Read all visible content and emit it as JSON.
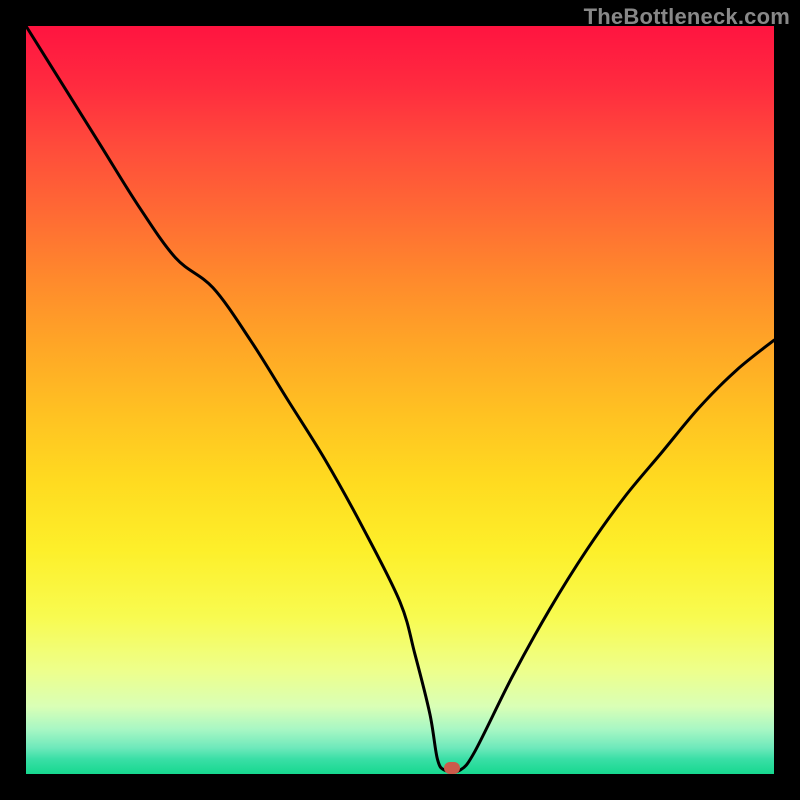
{
  "watermark": "TheBottleneck.com",
  "colors": {
    "frame": "#000000",
    "curve_stroke": "#000000",
    "marker": "#cb5b4b"
  },
  "chart_data": {
    "type": "line",
    "title": "",
    "xlabel": "",
    "ylabel": "",
    "xlim": [
      0,
      100
    ],
    "ylim": [
      0,
      100
    ],
    "grid": false,
    "legend": false,
    "x": [
      0,
      5,
      10,
      15,
      20,
      25,
      30,
      35,
      40,
      45,
      50,
      52,
      54,
      55,
      56,
      58,
      60,
      65,
      70,
      75,
      80,
      85,
      90,
      95,
      100
    ],
    "values": [
      100,
      92,
      84,
      76,
      69,
      65,
      58,
      50,
      42,
      33,
      23,
      16,
      8,
      2,
      0.5,
      0.5,
      3,
      13,
      22,
      30,
      37,
      43,
      49,
      54,
      58
    ],
    "marker": {
      "x": 57,
      "y": 0.8
    },
    "gradient_stops": [
      {
        "pos": 0,
        "color": "#ff1440"
      },
      {
        "pos": 25,
        "color": "#ff6a34"
      },
      {
        "pos": 52,
        "color": "#ffc222"
      },
      {
        "pos": 79,
        "color": "#f8fb50"
      },
      {
        "pos": 94,
        "color": "#a8f7c4"
      },
      {
        "pos": 100,
        "color": "#16d88f"
      }
    ]
  }
}
